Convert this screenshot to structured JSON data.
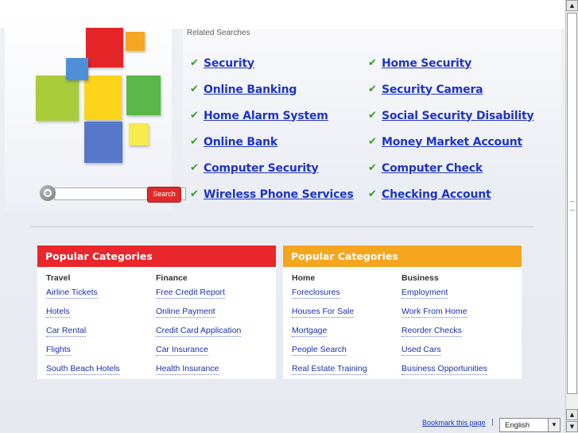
{
  "related": {
    "title": "Related Searches",
    "left": [
      "Security",
      "Online Banking",
      "Home Alarm System",
      "Online Bank",
      "Computer Security",
      "Wireless Phone Services"
    ],
    "right": [
      "Home Security",
      "Security Camera",
      "Social Security Disability",
      "Money Market Account",
      "Computer Check",
      "Checking Account"
    ]
  },
  "search": {
    "button_label": "Search",
    "value": ""
  },
  "categories": [
    {
      "title": "Popular Categories",
      "color": "#e8262b",
      "columns": [
        {
          "head": "Travel",
          "links": [
            "Airline Tickets",
            "Hotels",
            "Car Rental",
            "Flights",
            "South Beach Hotels"
          ]
        },
        {
          "head": "Finance",
          "links": [
            "Free Credit Report",
            "Online Payment",
            "Credit Card Application",
            "Car Insurance",
            "Health Insurance"
          ]
        }
      ]
    },
    {
      "title": "Popular Categories",
      "color": "#f5a51e",
      "columns": [
        {
          "head": "Home",
          "links": [
            "Foreclosures",
            "Houses For Sale",
            "Mortgage",
            "People Search",
            "Real Estate Training"
          ]
        },
        {
          "head": "Business",
          "links": [
            "Employment",
            "Work From Home",
            "Reorder Checks",
            "Used Cars",
            "Business Opportunities"
          ]
        }
      ]
    }
  ],
  "footer": {
    "bookmark": "Bookmark this page",
    "separator": "|",
    "language": "English"
  },
  "logo_colors": [
    "#e42527",
    "#f5a623",
    "#4f8fd8",
    "#a8cc3a",
    "#fcd51a",
    "#5ab849",
    "#5778c8",
    "#f7ea4c"
  ],
  "icons": {
    "check": "check-icon",
    "search": "search-icon"
  }
}
